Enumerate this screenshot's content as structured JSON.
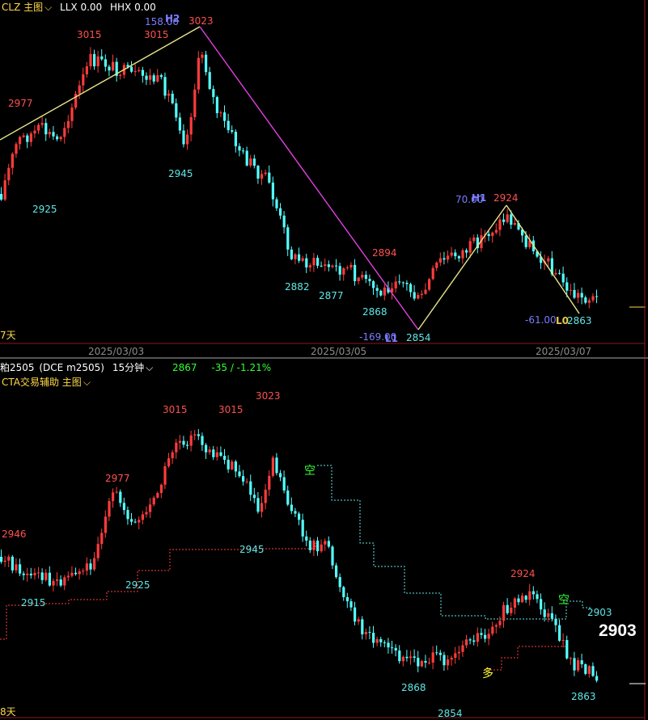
{
  "top": {
    "header": {
      "indicator": "CLZ 主图",
      "llx": "LLX 0.00",
      "hhx": "HHX 0.00"
    },
    "left_tag": "7天",
    "dates": [
      "2025/03/03",
      "2025/03/05",
      "2025/03/07"
    ],
    "price_labels": {
      "p3015a": "3015",
      "p3015b": "3015",
      "p3023": "3023",
      "p2977": "2977",
      "p2945": "2945",
      "p2925": "2925",
      "p2882": "2882",
      "p2877": "2877",
      "p2868": "2868",
      "p2894": "2894",
      "p2854": "2854",
      "p2924": "2924",
      "p2863": "2863"
    },
    "wave_labels": {
      "h2": "H2",
      "h2_val": "158.00",
      "l1": "L1",
      "l1_val": "-169.00",
      "h1": "H1",
      "h1_val": "70.00",
      "l0": "L0",
      "l0_val": "-61.00"
    }
  },
  "bottom": {
    "header": {
      "symbol": "粕2505",
      "symbol_detail": "(DCE m2505)",
      "period": "15分钟",
      "last_price": "2867",
      "change": "-35 / -1.21%"
    },
    "indicator": "CTA交易辅助 主图",
    "left_tag": "8天",
    "price_labels": {
      "p3015a": "3015",
      "p3015b": "3015",
      "p3023": "3023",
      "p2977": "2977",
      "p2946": "2946",
      "p2945": "2945",
      "p2915": "2915",
      "p2925": "2925",
      "p2868": "2868",
      "p2854": "2854",
      "p2924": "2924",
      "p2903": "2903",
      "p2863": "2863"
    },
    "signals": {
      "short1": "空",
      "short2": "空",
      "long1": "多"
    },
    "current_price": "2903"
  },
  "colors": {
    "up": "#ff3b3b",
    "down": "#54ffff",
    "yellow_line": "#e6e68a",
    "magenta_line": "#e040e0",
    "label_red": "#ff5050",
    "label_cyan": "#5fe8e8",
    "wave_blue": "#7b7bff",
    "signal_green": "#33ff33",
    "signal_yellow": "#ffff33"
  }
}
